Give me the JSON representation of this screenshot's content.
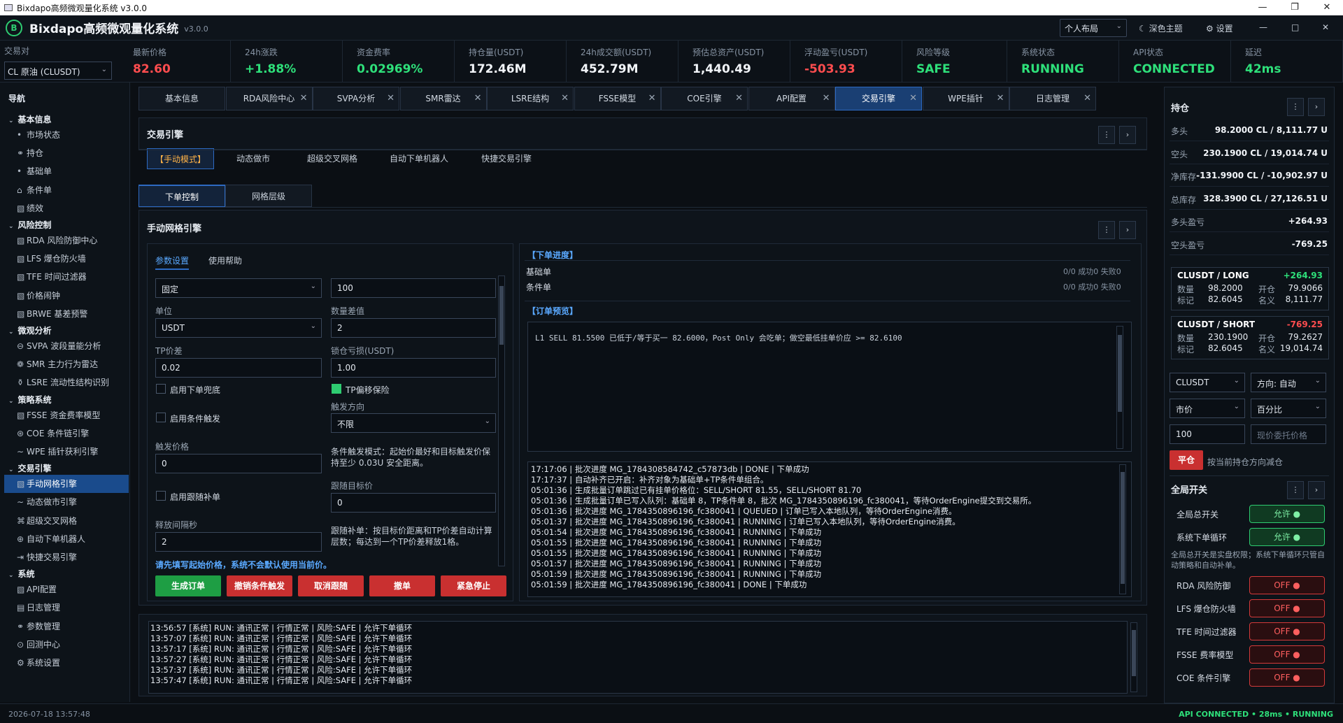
{
  "window": {
    "title": "Bixdapo高频微观量化系统 v3.0.0",
    "min": "—",
    "max": "❐",
    "close": "✕"
  },
  "header": {
    "logo": "B",
    "title": "Bixdapo高频微观量化系统",
    "version": "v3.0.0",
    "layout_select": "个人布局",
    "theme_btn": "深色主题",
    "settings_btn": "设置",
    "win_min": "—",
    "win_max": "□",
    "win_close": "✕"
  },
  "stats": {
    "pair_label": "交易对",
    "pair_value": "CL 原油 (CLUSDT)",
    "items": [
      {
        "label": "最新价格",
        "value": "82.60",
        "color": "#ff4d4f"
      },
      {
        "label": "24h涨跌",
        "value": "+1.88%",
        "color": "#2ee07a"
      },
      {
        "label": "资金费率",
        "value": "0.02969%",
        "color": "#2ee07a"
      },
      {
        "label": "持仓量(USDT)",
        "value": "172.46M",
        "color": "#f1f4f8"
      },
      {
        "label": "24h成交额(USDT)",
        "value": "452.79M",
        "color": "#f1f4f8"
      },
      {
        "label": "预估总资产(USDT)",
        "value": "1,440.49",
        "color": "#f1f4f8"
      },
      {
        "label": "浮动盈亏(USDT)",
        "value": "-503.93",
        "color": "#ff4d4f"
      },
      {
        "label": "风险等级",
        "value": "SAFE",
        "color": "#2ee07a"
      },
      {
        "label": "系统状态",
        "value": "RUNNING",
        "color": "#2ee07a"
      },
      {
        "label": "API状态",
        "value": "CONNECTED",
        "color": "#2ee07a"
      },
      {
        "label": "延迟",
        "value": "42ms",
        "color": "#2ee07a"
      }
    ]
  },
  "sidebar": {
    "title": "导航",
    "groups": [
      {
        "label": "基本信息",
        "items": [
          {
            "icon": "•",
            "label": "市场状态"
          },
          {
            "icon": "⚭",
            "label": "持仓"
          },
          {
            "icon": "•",
            "label": "基础单"
          },
          {
            "icon": "⌂",
            "label": "条件单"
          },
          {
            "icon": "▧",
            "label": "绩效"
          }
        ]
      },
      {
        "label": "风险控制",
        "items": [
          {
            "icon": "▧",
            "label": "RDA 风险防御中心"
          },
          {
            "icon": "▧",
            "label": "LFS 爆仓防火墙"
          },
          {
            "icon": "▧",
            "label": "TFE 时间过滤器"
          },
          {
            "icon": "▧",
            "label": "价格闹钟"
          },
          {
            "icon": "▧",
            "label": "BRWE 基差预警"
          }
        ]
      },
      {
        "label": "微观分析",
        "items": [
          {
            "icon": "⊖",
            "label": "SVPA 波段量能分析"
          },
          {
            "icon": "❁",
            "label": "SMR 主力行为雷达"
          },
          {
            "icon": "⚱",
            "label": "LSRE 流动性结构识别"
          }
        ]
      },
      {
        "label": "策略系统",
        "items": [
          {
            "icon": "▧",
            "label": "FSSE 资金费率模型"
          },
          {
            "icon": "⊛",
            "label": "COE 条件链引擎"
          },
          {
            "icon": "∼",
            "label": "WPE 插针获利引擎"
          }
        ]
      },
      {
        "label": "交易引擎",
        "items": [
          {
            "icon": "▧",
            "label": "手动网格引擎",
            "active": true
          },
          {
            "icon": "∼",
            "label": "动态做市引擎"
          },
          {
            "icon": "⌘",
            "label": "超级交叉网格"
          },
          {
            "icon": "⊕",
            "label": "自动下单机器人"
          },
          {
            "icon": "⇥",
            "label": "快捷交易引擎"
          }
        ]
      },
      {
        "label": "系统",
        "items": [
          {
            "icon": "▧",
            "label": "API配置"
          },
          {
            "icon": "▤",
            "label": "日志管理"
          },
          {
            "icon": "⚭",
            "label": "参数管理"
          },
          {
            "icon": "⊙",
            "label": "回测中心"
          },
          {
            "icon": "⚙",
            "label": "系统设置"
          }
        ]
      }
    ]
  },
  "tabs": [
    {
      "label": "基本信息"
    },
    {
      "label": "RDA风险中心",
      "x": "✕"
    },
    {
      "label": "SVPA分析",
      "x": "✕"
    },
    {
      "label": "SMR雷达",
      "x": "✕"
    },
    {
      "label": "LSRE结构",
      "x": "✕"
    },
    {
      "label": "FSSE模型",
      "x": "✕"
    },
    {
      "label": "COE引擎",
      "x": "✕"
    },
    {
      "label": "API配置",
      "x": "✕"
    },
    {
      "label": "交易引擎",
      "x": "✕",
      "active": true
    },
    {
      "label": "WPE插针",
      "x": "✕"
    },
    {
      "label": "日志管理",
      "x": "✕"
    }
  ],
  "engine": {
    "title": "交易引擎",
    "modes": [
      {
        "label": "【手动模式】",
        "active": true
      },
      {
        "label": "动态做市"
      },
      {
        "label": "超级交叉网格"
      },
      {
        "label": "自动下单机器人"
      },
      {
        "label": "快捷交易引擎"
      }
    ],
    "more": "⋮",
    "expand": "›"
  },
  "subtabs": [
    {
      "label": "下单控制",
      "active": true
    },
    {
      "label": "网格层级"
    }
  ],
  "grid": {
    "title": "手动网格引擎",
    "param_tab": "参数设置",
    "help_tab": "使用帮助",
    "mode_select": "固定",
    "top_value": "100",
    "unit_label": "单位",
    "unit_value": "USDT",
    "qty_diff_label": "数量差值",
    "qty_diff_value": "2",
    "tp_label": "TP价差",
    "tp_value": "0.02",
    "lock_label": "锁仓亏损(USDT)",
    "lock_value": "1.00",
    "chk_bottom": "启用下单兜底",
    "chk_tp": "TP偏移保险",
    "chk_cond": "启用条件触发",
    "trig_dir_label": "触发方向",
    "trig_dir_value": "不限",
    "trig_price_label": "触发价格",
    "trig_price_value": "0",
    "trig_note": "条件触发模式：起始价最好和目标触发价保持至少 0.03U 安全距离。",
    "chk_follow": "启用跟随补单",
    "follow_label": "跟随目标价",
    "follow_value": "0",
    "release_label": "释放间隔秒",
    "release_value": "2",
    "follow_note": "跟随补单：按目标价距离和TP价差自动计算层数；每达到一个TP价差释放1格。",
    "hint": "请先填写起始价格，系统不会默认使用当前价。",
    "buttons": [
      {
        "label": "生成订单",
        "kind": "g"
      },
      {
        "label": "撤销条件触发",
        "kind": "r"
      },
      {
        "label": "取消跟随",
        "kind": "r"
      },
      {
        "label": "撤单",
        "kind": "r"
      },
      {
        "label": "紧急停止",
        "kind": "r"
      }
    ]
  },
  "progress": {
    "title": "【下单进度】",
    "rows": [
      {
        "label": "基础单",
        "value": "0/0 成功0 失败0"
      },
      {
        "label": "条件单",
        "value": "0/0 成功0 失败0"
      }
    ],
    "preview_title": "【订单预览】",
    "preview_text": "L1 SELL 81.5500 已低于/等于买一 82.6000，Post Only 会吃单；做空最低挂单价应 >= 82.6100",
    "log": [
      "17:17:06 | 批次进度 MG_1784308584742_c57873db | DONE | 下单成功",
      "17:17:37 | 自动补齐已开启：补齐对象为基础单+TP条件单组合。",
      "05:01:36 | 生成批量订单跳过已有挂单价格位：SELL/SHORT 81.55，SELL/SHORT 81.70",
      "05:01:36 | 生成批量订单已写入队列：基础单 8，TP条件单 8，批次 MG_1784350896196_fc380041，等待OrderEngine提交到交易所。",
      "05:01:36 | 批次进度 MG_1784350896196_fc380041 | QUEUED | 订单已写入本地队列，等待OrderEngine消费。",
      "05:01:37 | 批次进度 MG_1784350896196_fc380041 | RUNNING | 订单已写入本地队列，等待OrderEngine消费。",
      "05:01:54 | 批次进度 MG_1784350896196_fc380041 | RUNNING | 下单成功",
      "05:01:55 | 批次进度 MG_1784350896196_fc380041 | RUNNING | 下单成功",
      "05:01:55 | 批次进度 MG_1784350896196_fc380041 | RUNNING | 下单成功",
      "05:01:57 | 批次进度 MG_1784350896196_fc380041 | RUNNING | 下单成功",
      "05:01:59 | 批次进度 MG_1784350896196_fc380041 | RUNNING | 下单成功",
      "05:01:59 | 批次进度 MG_1784350896196_fc380041 | DONE | 下单成功"
    ]
  },
  "syslog": [
    "13:56:57 [系统] RUN: 通讯正常 | 行情正常 | 风险:SAFE | 允许下单循环",
    "13:57:07 [系统] RUN: 通讯正常 | 行情正常 | 风险:SAFE | 允许下单循环",
    "13:57:17 [系统] RUN: 通讯正常 | 行情正常 | 风险:SAFE | 允许下单循环",
    "13:57:27 [系统] RUN: 通讯正常 | 行情正常 | 风险:SAFE | 允许下单循环",
    "13:57:37 [系统] RUN: 通讯正常 | 行情正常 | 风险:SAFE | 允许下单循环",
    "13:57:47 [系统] RUN: 通讯正常 | 行情正常 | 风险:SAFE | 允许下单循环"
  ],
  "positions": {
    "title": "持仓",
    "rows": [
      {
        "k": "多头",
        "v": "98.2000 CL / 8,111.77 U"
      },
      {
        "k": "空头",
        "v": "230.1900 CL / 19,014.74 U"
      },
      {
        "k": "净库存",
        "v": "-131.9900 CL / -10,902.97 U"
      },
      {
        "k": "总库存",
        "v": "328.3900 CL / 27,126.51 U"
      },
      {
        "k": "多头盈亏",
        "v": "+264.93"
      },
      {
        "k": "空头盈亏",
        "v": "-769.25"
      }
    ],
    "cards": [
      {
        "title": "CLUSDT / LONG",
        "pnl": "+264.93",
        "pnl_color": "#2ee07a",
        "qty_l": "数量",
        "qty": "98.2000",
        "open_l": "开仓",
        "open": "79.9066",
        "mark_l": "标记",
        "mark": "82.6045",
        "notional_l": "名义",
        "notional": "8,111.77"
      },
      {
        "title": "CLUSDT / SHORT",
        "pnl": "-769.25",
        "pnl_color": "#ff4d4f",
        "qty_l": "数量",
        "qty": "230.1900",
        "open_l": "开仓",
        "open": "79.2627",
        "mark_l": "标记",
        "mark": "82.6045",
        "notional_l": "名义",
        "notional": "19,014.74"
      }
    ],
    "sym_select": "CLUSDT",
    "dir_select": "方向: 自动",
    "type_select": "市价",
    "pct_select": "百分比",
    "qty_value": "100",
    "price_placeholder": "现价委托价格",
    "close_btn": "平仓",
    "close_hint": "按当前持仓方向减仓"
  },
  "switches": {
    "title": "全局开关",
    "main": [
      {
        "label": "全局总开关",
        "state": "允许 ●",
        "on": true
      },
      {
        "label": "系统下单循环",
        "state": "允许 ●",
        "on": true
      }
    ],
    "note": "全局总开关是实盘权限；系统下单循环只管自动策略和自动补单。",
    "modules": [
      {
        "label": "RDA 风险防御",
        "state": "OFF ●"
      },
      {
        "label": "LFS 爆仓防火墙",
        "state": "OFF ●"
      },
      {
        "label": "TFE 时间过滤器",
        "state": "OFF ●"
      },
      {
        "label": "FSSE 费率模型",
        "state": "OFF ●"
      },
      {
        "label": "COE 条件引擎",
        "state": "OFF ●"
      }
    ]
  },
  "statusbar": {
    "time": "2026-07-18 13:57:48",
    "right": "API CONNECTED • 28ms • RUNNING"
  }
}
